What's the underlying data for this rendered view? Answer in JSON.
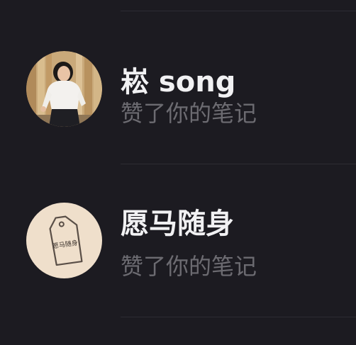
{
  "notifications": [
    {
      "user_name": "崧 song",
      "action_text": "赞了你的笔记",
      "avatar_icon": "person-photo-icon"
    },
    {
      "user_name": "愿马随身",
      "action_text": "赞了你的笔记",
      "avatar_icon": "tag-logo-icon",
      "avatar_logo_text": "愿马随身"
    }
  ],
  "colors": {
    "background": "#1c1b21",
    "divider": "#2d2c33",
    "name_text": "#f1f1f3",
    "sub_text": "#6c6b71",
    "logo_avatar_bg": "#efdfcb"
  }
}
